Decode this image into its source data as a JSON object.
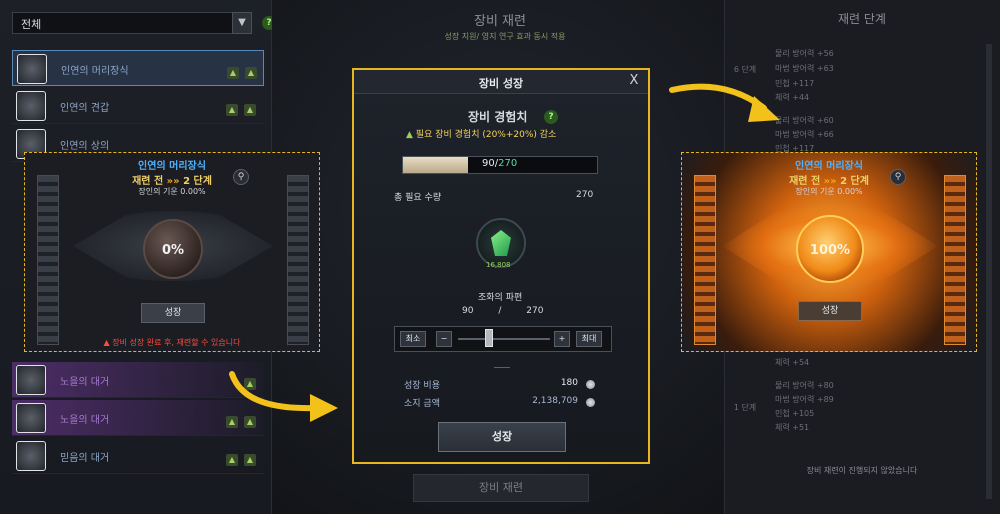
{
  "left_panel": {
    "filter_value": "전체",
    "help": "?",
    "items": [
      {
        "name": "인연의 머리장식"
      },
      {
        "name": "인연의 견갑"
      },
      {
        "name": "인연의 상의"
      },
      {
        "name": "노을의 대거"
      },
      {
        "name": "노을의 대거"
      },
      {
        "name": "믿음의 대거"
      }
    ]
  },
  "background": {
    "title": "장비 재련",
    "subtitle": "성장 지원/ 영지 연구 효과 동시 적용",
    "refine_button": "장비 재련"
  },
  "right_panel": {
    "title": "재련 단계",
    "stage_6": "6 단계",
    "stage_1": "1 단계",
    "stats_top": [
      "물리 방어력 +56",
      "마법 방어력 +63",
      "민첩 +117",
      "체력 +44",
      "물리 방어력 +60",
      "마법 방어력 +66",
      "민첩 +117"
    ],
    "stats_bottom": [
      "체력 +54",
      "물리 방어력 +80",
      "마법 방어력 +89",
      "민첩 +105",
      "체력 +51"
    ],
    "note": "장비 재련이 진행되지 않았습니다"
  },
  "preview_left": {
    "title": "인연의 머리장식",
    "stage_before": "재련 전",
    "stage_arrows": "»»",
    "stage_value": "2 단계",
    "meter": "장인의 기운 0.00%",
    "percent": "0%",
    "button": "성장",
    "warning": "장비 성장 완료 후, 재련할 수 있습니다"
  },
  "preview_right": {
    "title": "인연의 머리장식",
    "stage_before": "재련 전",
    "stage_arrows": "»»",
    "stage_value": "2 단계",
    "meter": "장인의 기운 0.00%",
    "percent": "100%",
    "button": "성장"
  },
  "modal": {
    "title": "장비 성장",
    "close": "X",
    "exp_title": "장비 경험치",
    "help": "?",
    "required": "필요 장비 경험치 (20%+20%) 감소",
    "exp_current": "90",
    "exp_sep": "/",
    "exp_max": "270",
    "exp_progress": 0.333,
    "total_label": "총 필요 수량",
    "total_value": "270",
    "gem_count": "16,808",
    "material_name": "조화의 파편",
    "mat_current": "90",
    "mat_sep": "/",
    "mat_max": "270",
    "min_label": "최소",
    "minus": "−",
    "plus": "+",
    "max_label": "최대",
    "slider_value": 0.333,
    "cost_label": "성장 비용",
    "cost_value": "180",
    "owned_label": "소지 금액",
    "owned_value": "2,138,709",
    "grow_button": "성장"
  },
  "colors": {
    "highlight_border": "#e8b620",
    "arrow": "#f2c21a",
    "blue_text": "#4fb2ff",
    "warning": "#ff4a3d",
    "exp_max": "#5fd8a8"
  }
}
